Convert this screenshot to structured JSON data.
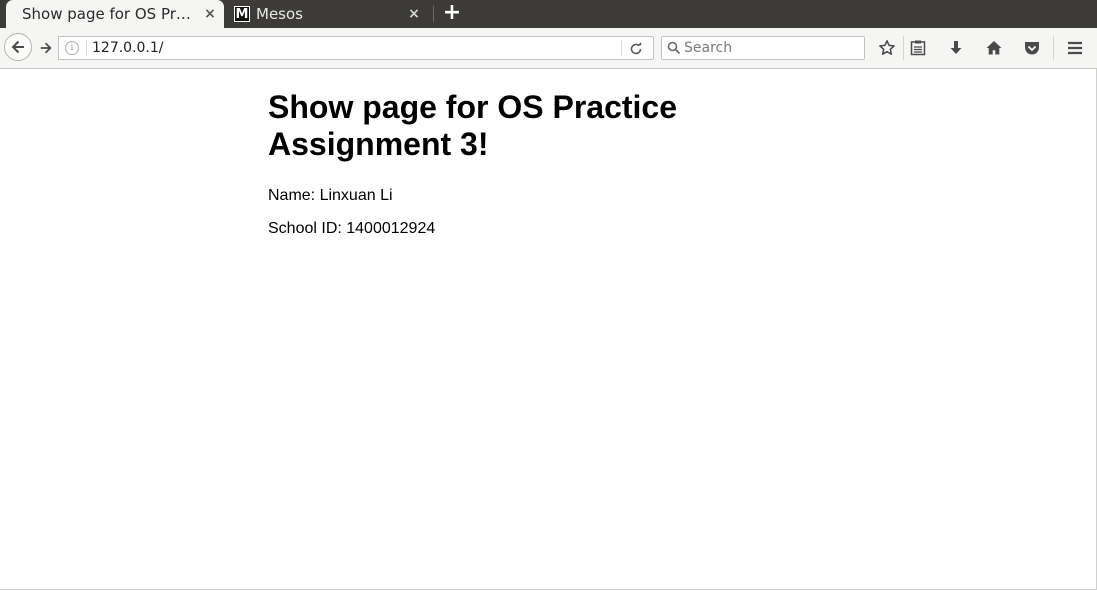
{
  "browser": {
    "tabs": [
      {
        "title": "Show page for OS Practice Assignment 3!",
        "active": true,
        "close_label": "×"
      },
      {
        "title": "Mesos",
        "favicon_letter": "M",
        "active": false,
        "close_label": "×"
      }
    ],
    "new_tab_label": "+",
    "url": "127.0.0.1/",
    "search_placeholder": "Search",
    "info_glyph": "i",
    "icons": {
      "back": "back-arrow-icon",
      "forward": "forward-arrow-icon",
      "reload": "reload-icon",
      "search": "search-icon",
      "bookmark": "star-icon",
      "reading_list": "clipboard-icon",
      "downloads": "download-arrow-icon",
      "home": "home-icon",
      "pocket": "pocket-icon",
      "menu": "hamburger-menu-icon"
    },
    "colors": {
      "tabstrip_bg": "#3c3b37",
      "toolbar_bg": "#f5f5f4",
      "page_bg": "#ffffff"
    }
  },
  "page": {
    "heading": "Show page for OS Practice Assignment 3!",
    "name_line": "Name: Linxuan Li",
    "school_id_line": "School ID: 1400012924"
  }
}
